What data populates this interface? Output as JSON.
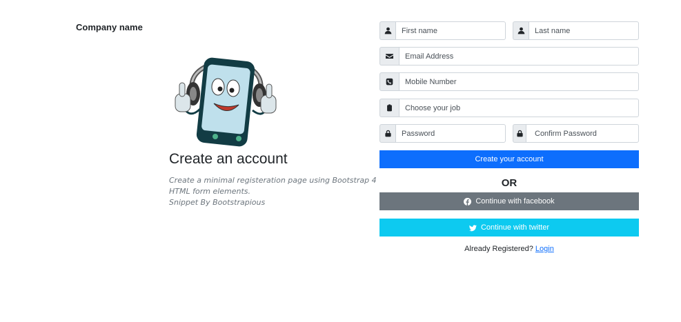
{
  "brand": {
    "name": "Company name"
  },
  "intro": {
    "heading": "Create an account",
    "description_line1": "Create a minimal registeration page using Bootstrap 4",
    "description_line2": "HTML form elements.",
    "credit": "Snippet By Bootstrapious"
  },
  "form": {
    "first_name": {
      "placeholder": "First name",
      "icon": "user-icon"
    },
    "last_name": {
      "placeholder": "Last name",
      "icon": "user-icon"
    },
    "email": {
      "placeholder": "Email Address",
      "icon": "envelope-icon"
    },
    "mobile": {
      "placeholder": "Mobile Number",
      "icon": "phone-icon"
    },
    "job": {
      "placeholder": "Choose your job",
      "icon": "clipboard-icon"
    },
    "password": {
      "placeholder": "Password",
      "icon": "lock-icon"
    },
    "confirm_password": {
      "placeholder": "Confirm Password",
      "icon": "lock-icon"
    },
    "submit_label": "Create your account",
    "divider": "OR",
    "facebook_label": "Continue with facebook",
    "twitter_label": "Continue with twitter",
    "login_prompt": "Already Registered?",
    "login_link": "Login"
  },
  "colors": {
    "primary": "#0d6efd",
    "facebook_button": "#6c757d",
    "twitter_button": "#0dcaf0"
  }
}
